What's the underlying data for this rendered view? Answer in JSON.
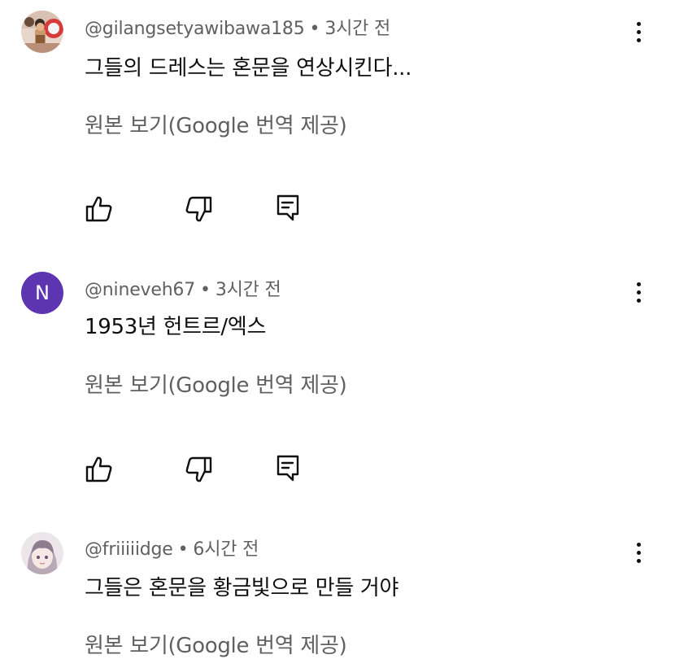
{
  "comments": [
    {
      "author": "@gilangsetyawibawa185",
      "time": "3시간 전",
      "text": "그들의 드레스는 혼문을 연상시킨다...",
      "translate_label": "원본 보기(Google 번역 제공)"
    },
    {
      "author": "@nineveh67",
      "time": "3시간 전",
      "avatar_letter": "N",
      "text": "1953년 헌트르/엑스",
      "translate_label": "원본 보기(Google 번역 제공)"
    },
    {
      "author": "@friiiiidge",
      "time": "6시간 전",
      "text": "그들은 혼문을 황금빛으로 만들 거야",
      "translate_label": "원본 보기(Google 번역 제공)"
    }
  ],
  "separator": "•",
  "icons": {
    "like": "thumbs-up-icon",
    "dislike": "thumbs-down-icon",
    "reply": "reply-icon",
    "more": "more-vert-icon"
  },
  "colors": {
    "text_primary": "#0f0f0f",
    "text_secondary": "#606060",
    "avatar_n": "#5e35b1"
  }
}
